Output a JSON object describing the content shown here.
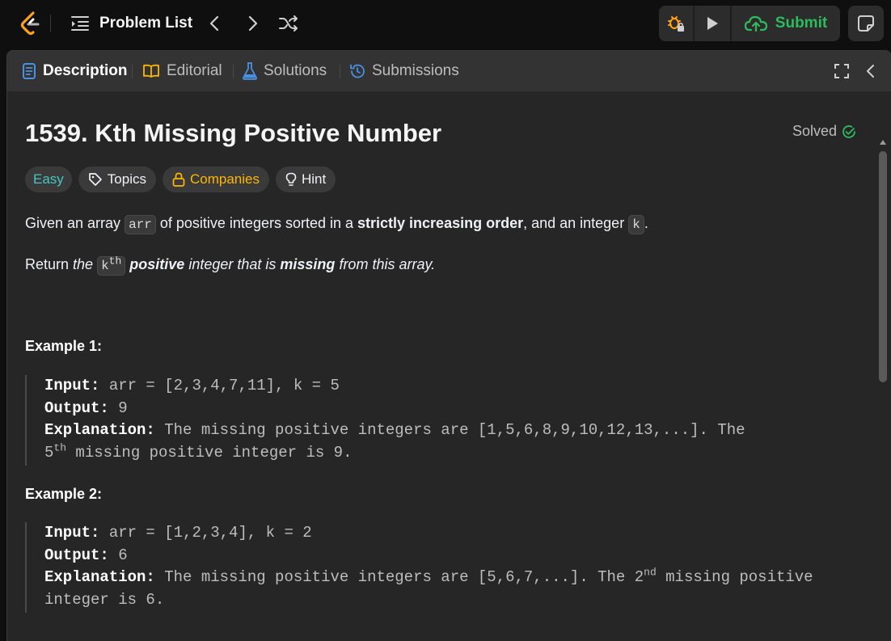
{
  "topbar": {
    "problem_list_label": "Problem List",
    "submit_label": "Submit"
  },
  "tabs": [
    {
      "label": "Description",
      "icon": "description-icon"
    },
    {
      "label": "Editorial",
      "icon": "book-icon"
    },
    {
      "label": "Solutions",
      "icon": "flask-icon"
    },
    {
      "label": "Submissions",
      "icon": "history-icon"
    }
  ],
  "problem": {
    "title": "1539. Kth Missing Positive Number",
    "status": "Solved",
    "difficulty": "Easy",
    "tags": [
      "Topics",
      "Companies",
      "Hint"
    ],
    "para1": {
      "t1": "Given an array ",
      "code1": "arr",
      "t2": " of positive integers sorted in a ",
      "strong1": "strictly increasing order",
      "t3": ", and an integer ",
      "code2": "k",
      "t4": "."
    },
    "para2": {
      "t1": "Return ",
      "em1": "the ",
      "code_base": "k",
      "code_sup": "th",
      "strong1": "positive",
      "em2": " integer that is ",
      "strong2": "missing",
      "em3": " from this array."
    }
  },
  "examples": [
    {
      "title": "Example 1:",
      "input_label": "Input:",
      "input": "arr = [2,3,4,7,11], k = 5",
      "output_label": "Output:",
      "output": "9",
      "explanation_label": "Explanation:",
      "explanation_a": "The missing positive integers are [1,5,6,8,9,10,12,13,...]. The",
      "explanation_b_num": "5",
      "explanation_b_sup": "th",
      "explanation_b_rest": " missing positive integer is 9."
    },
    {
      "title": "Example 2:",
      "input_label": "Input:",
      "input": "arr = [1,2,3,4], k = 2",
      "output_label": "Output:",
      "output": "6",
      "explanation_label": "Explanation:",
      "explanation_a": "The missing positive integers are [5,6,7,...]. The 2",
      "explanation_a_sup": "nd",
      "explanation_a_rest": " missing positive",
      "explanation_b": "integer is 6."
    }
  ],
  "colors": {
    "easy": "#46c6c2",
    "companies": "#ffb700",
    "submit": "#2cbb5d",
    "solved_check": "#2cbb5d",
    "tab_icon_blue": "#4a90e2",
    "editorial_icon": "#ffb700"
  }
}
